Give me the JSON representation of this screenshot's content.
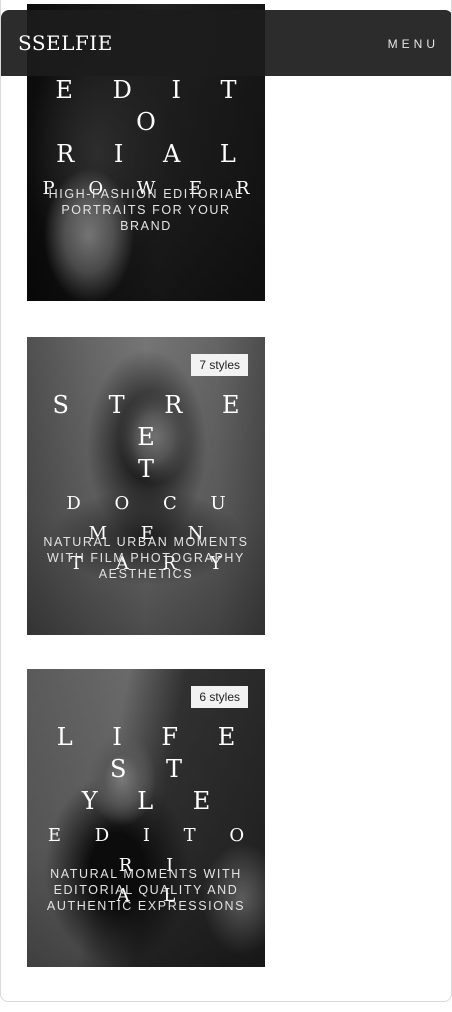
{
  "header": {
    "logo": "SSELFIE",
    "menu_label": "MENU"
  },
  "cards": [
    {
      "title_lines": [
        "E D I T O",
        "R I A L"
      ],
      "subtitle": "P O W E R",
      "description": "HIGH-FASHION EDITORIAL PORTRAITS FOR YOUR BRAND"
    },
    {
      "badge": "7 styles",
      "title_lines": [
        "S T R E E",
        "T"
      ],
      "subtitle_lines": [
        "D O C U M E N",
        "T A R Y"
      ],
      "description": "NATURAL URBAN MOMENTS WITH FILM PHOTOGRAPHY AESTHETICS"
    },
    {
      "badge": "6 styles",
      "title_lines": [
        "L I F E S T",
        "Y L E"
      ],
      "subtitle_lines": [
        "E D I T O R I",
        "A L"
      ],
      "description": "NATURAL MOMENTS WITH EDITORIAL QUALITY AND AUTHENTIC EXPRESSIONS"
    }
  ]
}
